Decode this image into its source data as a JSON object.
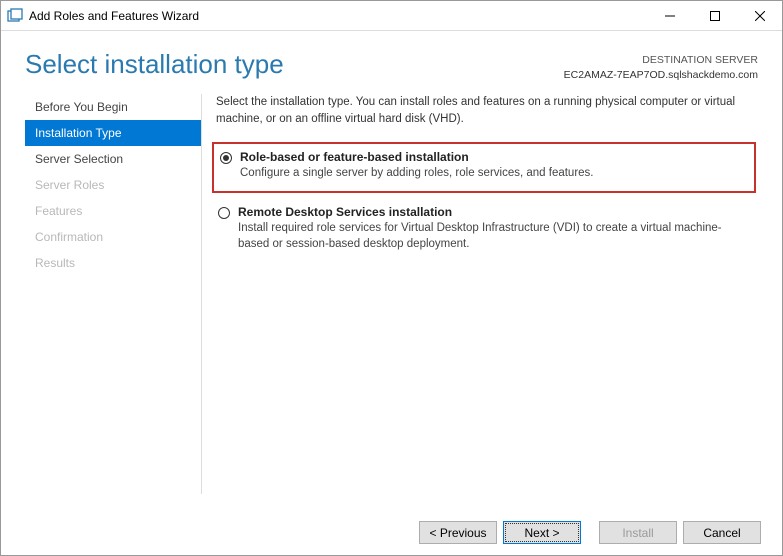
{
  "window": {
    "title": "Add Roles and Features Wizard"
  },
  "header": {
    "page_title": "Select installation type",
    "destination_label": "DESTINATION SERVER",
    "destination_value": "EC2AMAZ-7EAP7OD.sqlshackdemo.com"
  },
  "sidebar": {
    "items": [
      {
        "label": "Before You Begin",
        "state": "normal"
      },
      {
        "label": "Installation Type",
        "state": "active"
      },
      {
        "label": "Server Selection",
        "state": "normal"
      },
      {
        "label": "Server Roles",
        "state": "disabled"
      },
      {
        "label": "Features",
        "state": "disabled"
      },
      {
        "label": "Confirmation",
        "state": "disabled"
      },
      {
        "label": "Results",
        "state": "disabled"
      }
    ]
  },
  "content": {
    "intro": "Select the installation type. You can install roles and features on a running physical computer or virtual machine, or on an offline virtual hard disk (VHD).",
    "options": [
      {
        "title": "Role-based or feature-based installation",
        "desc": "Configure a single server by adding roles, role services, and features.",
        "selected": true,
        "highlight": true
      },
      {
        "title": "Remote Desktop Services installation",
        "desc": "Install required role services for Virtual Desktop Infrastructure (VDI) to create a virtual machine-based or session-based desktop deployment.",
        "selected": false,
        "highlight": false
      }
    ]
  },
  "footer": {
    "previous": "< Previous",
    "next": "Next >",
    "install": "Install",
    "cancel": "Cancel"
  }
}
